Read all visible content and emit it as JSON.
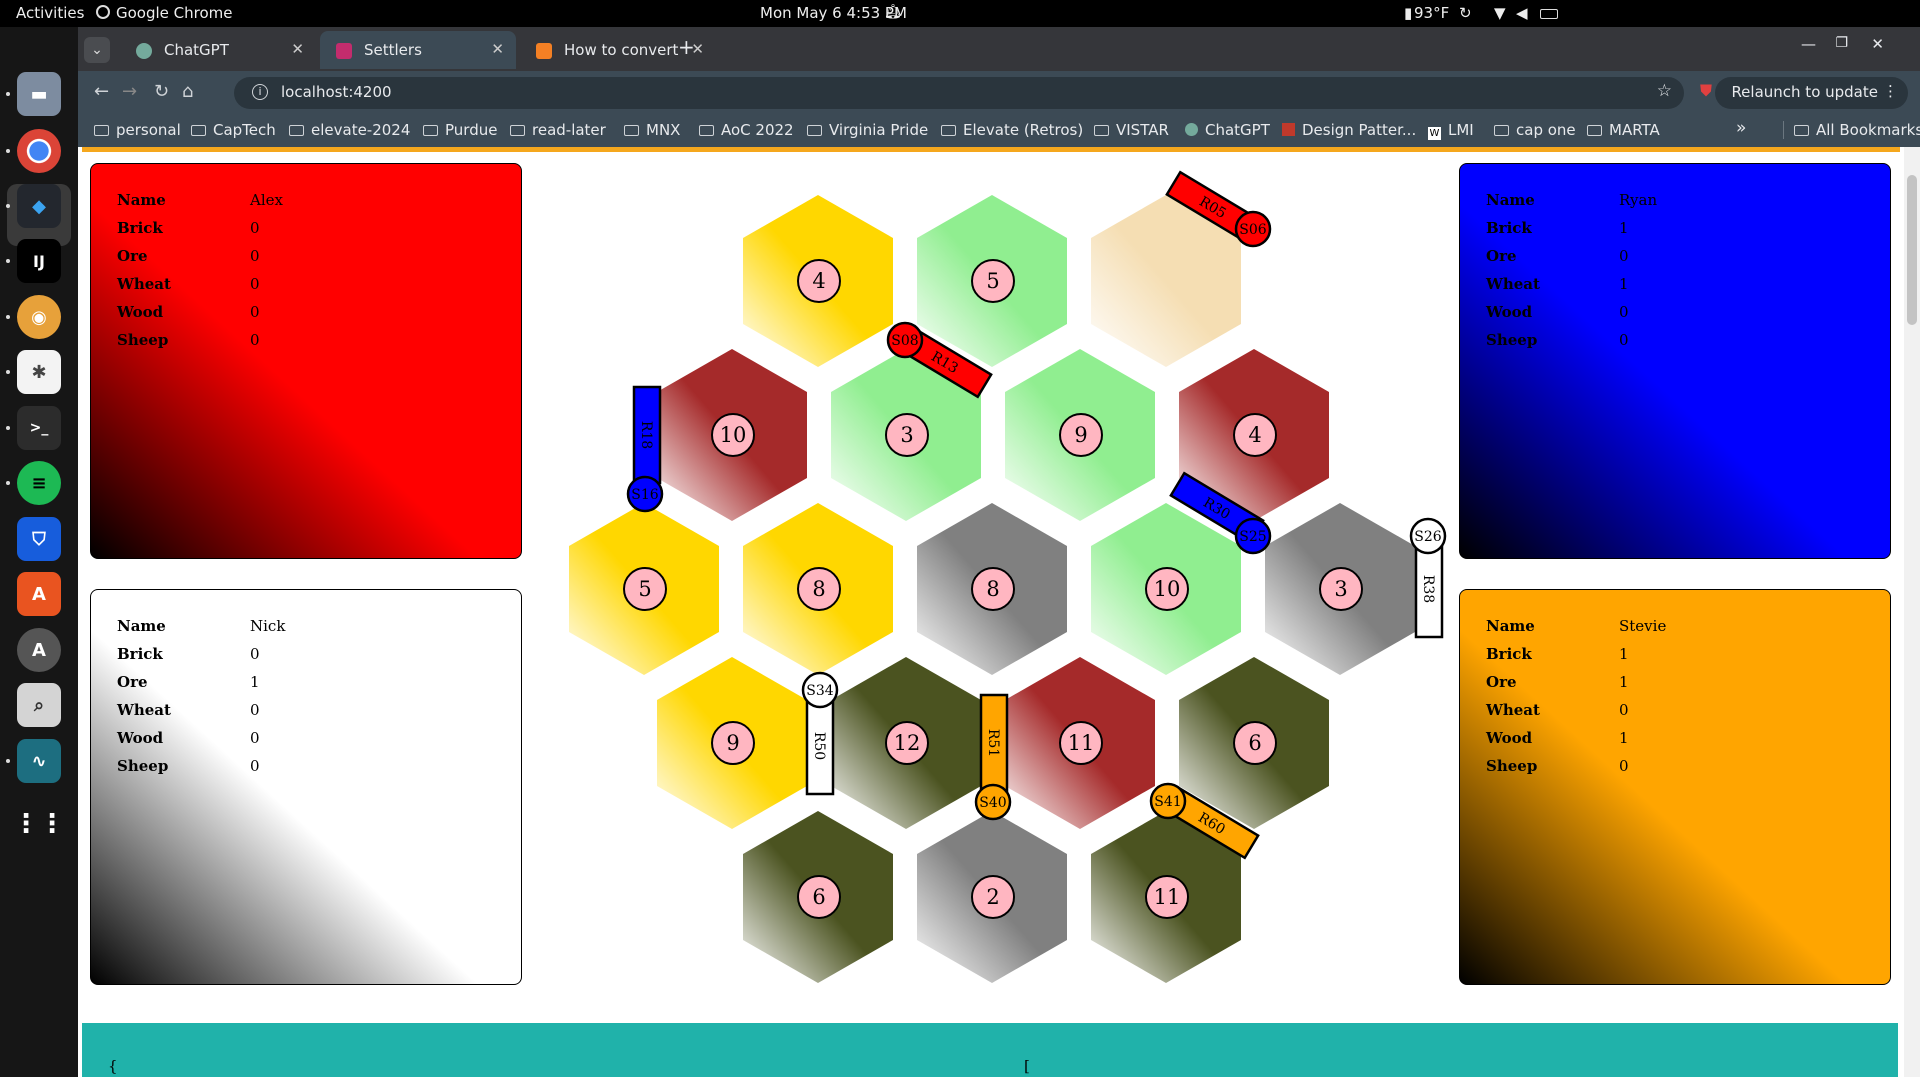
{
  "system_bar": {
    "activities": "Activities",
    "app_name": "Google Chrome",
    "datetime": "Mon May 6  4:53 PM",
    "temperature": "93°F"
  },
  "tabs": [
    {
      "label": "ChatGPT",
      "active": false
    },
    {
      "label": "Settlers",
      "active": true
    },
    {
      "label": "How to convert a string i",
      "active": false
    }
  ],
  "toolbar": {
    "url": "localhost:4200",
    "relaunch": "Relaunch to update"
  },
  "bookmarks": {
    "items": [
      "personal",
      "CapTech",
      "elevate-2024",
      "Purdue",
      "read-later",
      "MNX",
      "AoC 2022",
      "Virginia Pride",
      "Elevate (Retros)",
      "VISTAR",
      "ChatGPT",
      "Design Patter...",
      "LMI",
      "cap one",
      "MARTA"
    ],
    "all": "All Bookmarks"
  },
  "field_labels": [
    "Name",
    "Brick",
    "Ore",
    "Wheat",
    "Wood",
    "Sheep"
  ],
  "players": [
    {
      "name": "Alex",
      "brick": "0",
      "ore": "0",
      "wheat": "0",
      "wood": "0",
      "sheep": "0",
      "color": "#ff0000"
    },
    {
      "name": "Ryan",
      "brick": "1",
      "ore": "0",
      "wheat": "1",
      "wood": "0",
      "sheep": "0",
      "color": "#0000ff"
    },
    {
      "name": "Nick",
      "brick": "0",
      "ore": "1",
      "wheat": "0",
      "wood": "0",
      "sheep": "0",
      "color": "#ffffff"
    },
    {
      "name": "Stevie",
      "brick": "1",
      "ore": "1",
      "wheat": "0",
      "wood": "1",
      "sheep": "0",
      "color": "#ffa500"
    }
  ],
  "board": {
    "tiles": [
      {
        "number": "4",
        "terrain": "wheat"
      },
      {
        "number": "5",
        "terrain": "sheep"
      },
      {
        "number": "",
        "terrain": "desert"
      },
      {
        "number": "10",
        "terrain": "brick"
      },
      {
        "number": "3",
        "terrain": "sheep"
      },
      {
        "number": "9",
        "terrain": "sheep"
      },
      {
        "number": "4",
        "terrain": "brick"
      },
      {
        "number": "5",
        "terrain": "wheat"
      },
      {
        "number": "8",
        "terrain": "wheat"
      },
      {
        "number": "8",
        "terrain": "ore"
      },
      {
        "number": "10",
        "terrain": "sheep"
      },
      {
        "number": "3",
        "terrain": "ore"
      },
      {
        "number": "9",
        "terrain": "wheat"
      },
      {
        "number": "12",
        "terrain": "wood"
      },
      {
        "number": "11",
        "terrain": "brick"
      },
      {
        "number": "6",
        "terrain": "wood"
      },
      {
        "number": "6",
        "terrain": "wood"
      },
      {
        "number": "2",
        "terrain": "ore"
      },
      {
        "number": "11",
        "terrain": "wood"
      }
    ],
    "roads": [
      {
        "label": "R05",
        "owner": "red"
      },
      {
        "label": "R13",
        "owner": "red"
      },
      {
        "label": "R18",
        "owner": "blue"
      },
      {
        "label": "R30",
        "owner": "blue"
      },
      {
        "label": "R38",
        "owner": "white"
      },
      {
        "label": "R50",
        "owner": "white"
      },
      {
        "label": "R51",
        "owner": "orange"
      },
      {
        "label": "R60",
        "owner": "orange"
      }
    ],
    "settlements": [
      {
        "label": "S06",
        "owner": "red"
      },
      {
        "label": "S08",
        "owner": "red"
      },
      {
        "label": "S16",
        "owner": "blue"
      },
      {
        "label": "S25",
        "owner": "blue"
      },
      {
        "label": "S26",
        "owner": "white"
      },
      {
        "label": "S34",
        "owner": "white"
      },
      {
        "label": "S40",
        "owner": "orange"
      },
      {
        "label": "S41",
        "owner": "orange"
      }
    ],
    "terrain_colors": {
      "wheat": "#ffd700",
      "sheep": "#90ee90",
      "desert": "#f5deb3",
      "brick": "#a52a2a",
      "ore": "#808080",
      "wood": "#4b5320"
    },
    "owner_colors": {
      "red": "#ff0000",
      "blue": "#0000ff",
      "white": "#ffffff",
      "orange": "#ffa500"
    },
    "number_token_color": "#ffb6c1"
  },
  "footer": {
    "left_brace": "{",
    "right_brace": "["
  }
}
